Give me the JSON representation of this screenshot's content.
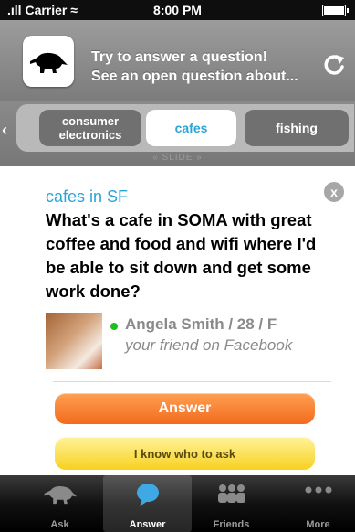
{
  "status": {
    "carrier": "Carrier",
    "time": "8:00 PM"
  },
  "header": {
    "prompt_line1": "Try to answer a question!",
    "prompt_line2": "See an open question about..."
  },
  "categories": [
    {
      "label": "consumer electronics",
      "selected": false
    },
    {
      "label": "cafes",
      "selected": true
    },
    {
      "label": "fishing",
      "selected": false
    }
  ],
  "slide_hint": "« SLIDE »",
  "question": {
    "topic": "cafes in SF",
    "text": "What's a cafe in SOMA with great coffee and food and wifi where I'd be able to sit down and get some work done?",
    "close_label": "x"
  },
  "asker": {
    "name": "Angela Smith / 28 / F",
    "relation": "your friend on Facebook"
  },
  "buttons": {
    "answer": "Answer",
    "know_who": "I know who to ask"
  },
  "tabs": [
    {
      "label": "Ask",
      "icon": "aardvark-icon"
    },
    {
      "label": "Answer",
      "icon": "speech-bubble-icon",
      "active": true
    },
    {
      "label": "Friends",
      "icon": "people-icon"
    },
    {
      "label": "More",
      "icon": "ellipsis-icon"
    }
  ],
  "colors": {
    "accent_blue": "#2aa5d8",
    "answer_orange": "#f26b1e",
    "know_yellow": "#f7d11f"
  }
}
